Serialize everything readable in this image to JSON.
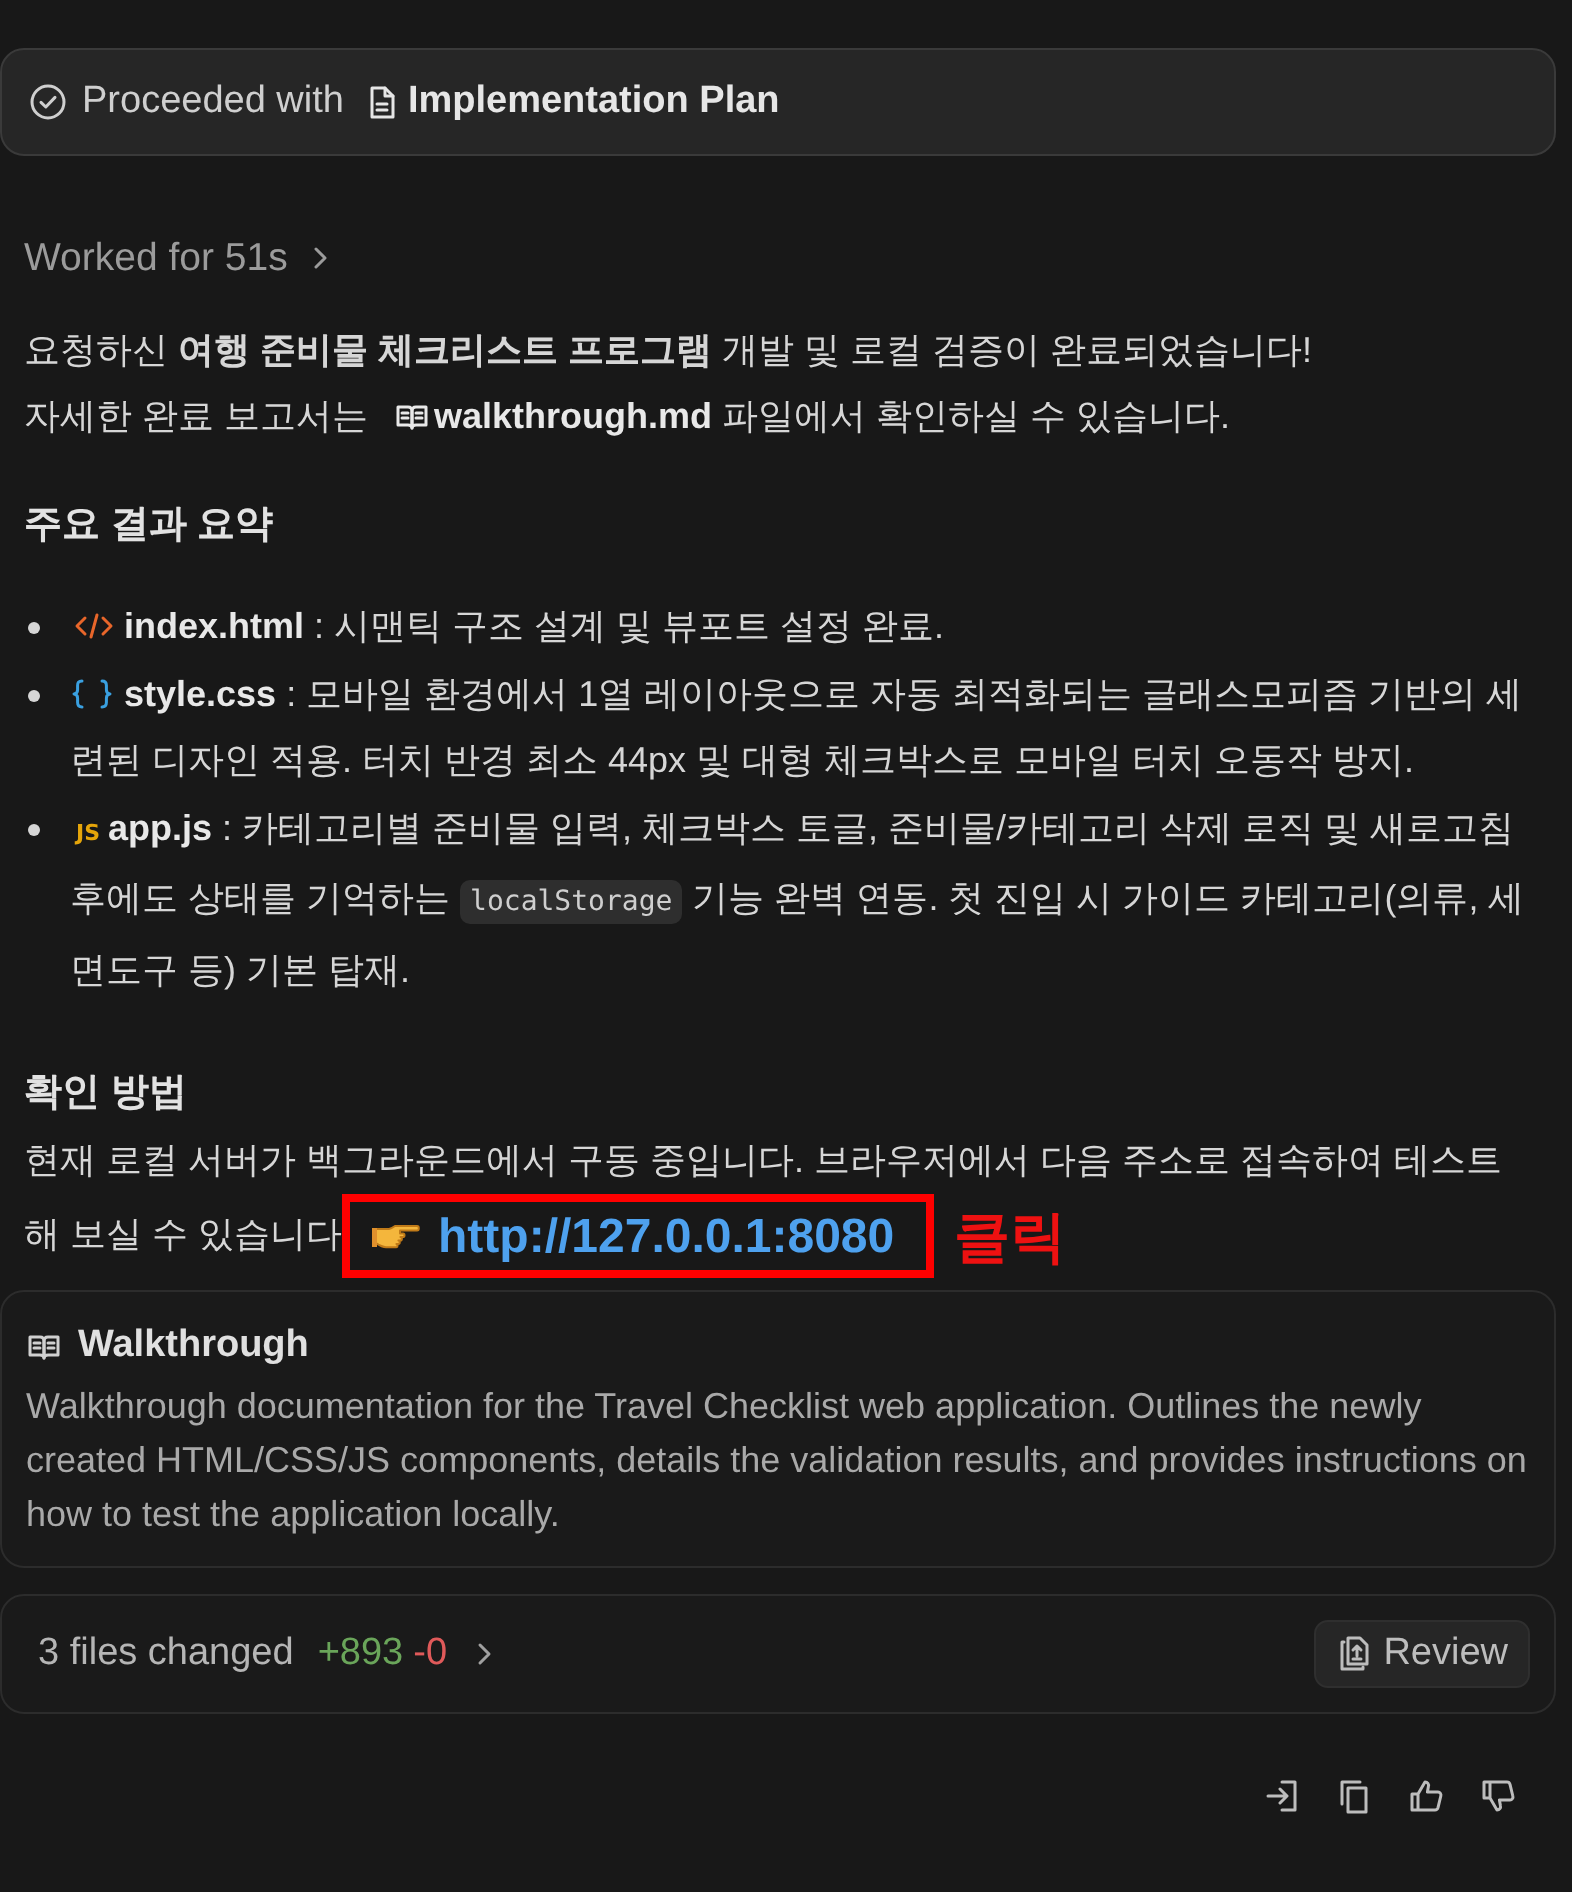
{
  "proceeded_bar": {
    "label": "Proceeded with",
    "document": "Implementation Plan"
  },
  "worked_for": "Worked for 51s",
  "intro": {
    "line_1": "요청하신 **여행 준비물 체크리스트 프로그램** 개발 및 로컬 검증이 완료되었습니다!",
    "line_2_before": "자세한 완료 보고서는",
    "file_link": "walkthrough.md",
    "line_2_after": "파일에서 확인하실 수 있습니다."
  },
  "summary": {
    "heading": "주요 결과 요약",
    "items": [
      {
        "kind": "html",
        "file": "index.html",
        "text": ": 시맨틱 구조 설계 및 뷰포트 설정 완료."
      },
      {
        "kind": "css",
        "file": "style.css",
        "text": ": 모바일 환경에서 1열 레이아웃으로 자동 최적화되는 글래스모피즘 기반의 세련된 디자인 적용. 터치 반경 최소 44px 및 대형 체크박스로 모바일 터치 오동작 방지."
      },
      {
        "kind": "js",
        "icon_text": "JS",
        "file": "app.js",
        "text": ": 카테고리별 준비물 입력, 체크박스 토글, 준비물/카테고리 삭제 로직 및 새로고침 후에도 상태를 기억하는",
        "code": "localStorage",
        "text_after": "기능 완벽 연동. 첫 진입 시 가이드 카테고리(의류, 세면도구 등) 기본 탑재."
      }
    ]
  },
  "check": {
    "heading": "확인 방법",
    "text": "현재 로컬 서버가 백그라운드에서 구동 중입니다. 브라우저에서 다음 주소로 접속하여 테스트 해 보실 수 있습니다",
    "link": "http://127.0.0.1:8080",
    "annotation": "클릭"
  },
  "walkthrough_card": {
    "title": "Walkthrough",
    "description": "Walkthrough documentation for the Travel Checklist web application. Outlines the newly created HTML/CSS/JS components, details the validation results, and provides instructions on how to test the application locally."
  },
  "changes_bar": {
    "summary": "3 files changed",
    "added": "+893",
    "removed": "-0",
    "button": "Review"
  }
}
